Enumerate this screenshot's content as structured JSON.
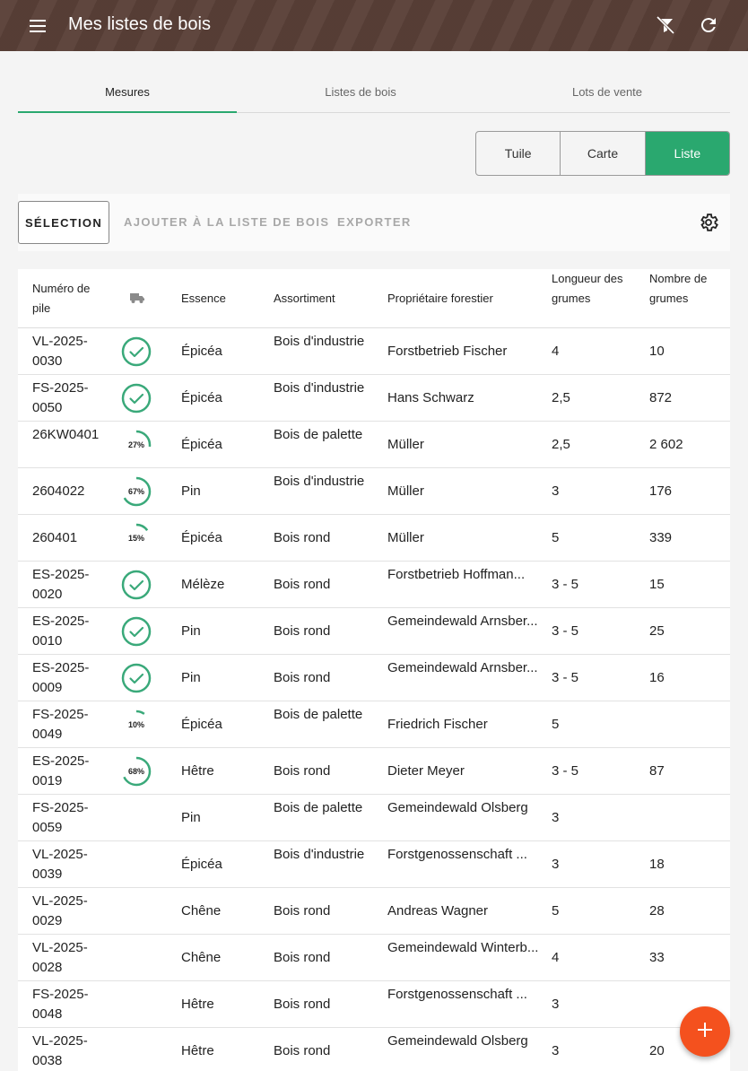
{
  "appbar": {
    "title": "Mes listes de bois",
    "icons": [
      "menu-icon",
      "filter-off-icon",
      "refresh-icon"
    ],
    "background_color": "#5a4038"
  },
  "tabs": [
    {
      "label": "Mesures",
      "active": true
    },
    {
      "label": "Listes de bois",
      "active": false
    },
    {
      "label": "Lots de vente",
      "active": false
    }
  ],
  "view_toggle": {
    "options": [
      "Tuile",
      "Carte",
      "Liste"
    ],
    "selected": "Liste",
    "accent_color": "#2aa86f"
  },
  "toolbar": {
    "selection_label": "SÉLECTION",
    "add_to_list_label": "AJOUTER À LA LISTE DE BOIS",
    "export_label": "EXPORTER"
  },
  "table": {
    "headers": {
      "number": "Numéro de pile",
      "status_icon": "truck-icon",
      "species": "Essence",
      "assortment": "Assortiment",
      "owner": "Propriétaire forestier",
      "length": "Longueur des grumes",
      "count": "Nombre de grumes"
    },
    "rows": [
      {
        "number": "VL-2025-0030",
        "status": "done",
        "progress": "",
        "species": "Épicéa",
        "assortment": "Bois d'industrie",
        "owner": "Forstbetrieb Fischer",
        "length": "4",
        "count": "10"
      },
      {
        "number": "FS-2025-0050",
        "status": "done",
        "progress": "",
        "species": "Épicéa",
        "assortment": "Bois d'industrie",
        "owner": "Hans Schwarz",
        "length": "2,5",
        "count": "872"
      },
      {
        "number": "26KW0401",
        "status": "progress",
        "progress": "27%",
        "species": "Épicéa",
        "assortment": "Bois de palette",
        "owner": "Müller",
        "length": "2,5",
        "count": "2 602"
      },
      {
        "number": "2604022",
        "status": "progress",
        "progress": "67%",
        "species": "Pin",
        "assortment": "Bois d'industrie",
        "owner": "Müller",
        "length": "3",
        "count": "176"
      },
      {
        "number": "260401",
        "status": "progress",
        "progress": "15%",
        "species": "Épicéa",
        "assortment": "Bois rond",
        "owner": "Müller",
        "length": "5",
        "count": "339"
      },
      {
        "number": "ES-2025-0020",
        "status": "done",
        "progress": "",
        "species": "Mélèze",
        "assortment": "Bois rond",
        "owner": "Forstbetrieb Hoffman...",
        "length": "3 - 5",
        "count": "15"
      },
      {
        "number": "ES-2025-0010",
        "status": "done",
        "progress": "",
        "species": "Pin",
        "assortment": "Bois rond",
        "owner": "Gemeindewald Arnsber...",
        "length": "3 - 5",
        "count": "25"
      },
      {
        "number": "ES-2025-0009",
        "status": "done",
        "progress": "",
        "species": "Pin",
        "assortment": "Bois rond",
        "owner": "Gemeindewald Arnsber...",
        "length": "3 - 5",
        "count": "16"
      },
      {
        "number": "FS-2025-0049",
        "status": "progress",
        "progress": "10%",
        "species": "Épicéa",
        "assortment": "Bois de palette",
        "owner": "Friedrich Fischer",
        "length": "5",
        "count": ""
      },
      {
        "number": "ES-2025-0019",
        "status": "progress",
        "progress": "68%",
        "species": "Hêtre",
        "assortment": "Bois rond",
        "owner": "Dieter Meyer",
        "length": "3 - 5",
        "count": "87"
      },
      {
        "number": "FS-2025-0059",
        "status": "none",
        "progress": "",
        "species": "Pin",
        "assortment": "Bois de palette",
        "owner": "Gemeindewald Olsberg",
        "length": "3",
        "count": ""
      },
      {
        "number": "VL-2025-0039",
        "status": "none",
        "progress": "",
        "species": "Épicéa",
        "assortment": "Bois d'industrie",
        "owner": "Forstgenossenschaft ...",
        "length": "3",
        "count": "18"
      },
      {
        "number": "VL-2025-0029",
        "status": "none",
        "progress": "",
        "species": "Chêne",
        "assortment": "Bois rond",
        "owner": "Andreas Wagner",
        "length": "5",
        "count": "28"
      },
      {
        "number": "VL-2025-0028",
        "status": "none",
        "progress": "",
        "species": "Chêne",
        "assortment": "Bois rond",
        "owner": "Gemeindewald Winterb...",
        "length": "4",
        "count": "33"
      },
      {
        "number": "FS-2025-0048",
        "status": "none",
        "progress": "",
        "species": "Hêtre",
        "assortment": "Bois rond",
        "owner": "Forstgenossenschaft ...",
        "length": "3",
        "count": ""
      },
      {
        "number": "VL-2025-0038",
        "status": "none",
        "progress": "",
        "species": "Hêtre",
        "assortment": "Bois rond",
        "owner": "Gemeindewald Olsberg",
        "length": "3",
        "count": "20"
      }
    ]
  },
  "fab": {
    "icon": "plus-icon",
    "color": "#f4511e"
  }
}
